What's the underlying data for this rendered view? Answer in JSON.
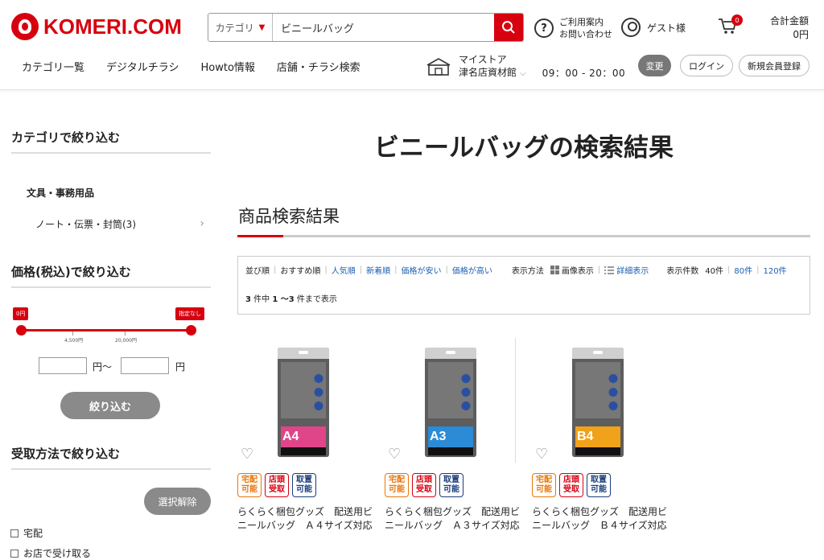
{
  "header": {
    "logo_text": "KOMERI.COM",
    "search": {
      "category_label": "カテゴリ",
      "query": "ビニールバッグ"
    },
    "help_line1": "ご利用案内",
    "help_line2": "お問い合わせ",
    "guest_label": "ゲスト様",
    "cart_count": "0",
    "total_label": "合計金額",
    "total_value": "0円",
    "nav": [
      "カテゴリ一覧",
      "デジタルチラシ",
      "Howto情報",
      "店舗・チラシ検索"
    ],
    "store": {
      "line1": "マイストア",
      "line2": "津名店資材館",
      "hours": "09：00 - 20：00"
    },
    "change_button": "変更",
    "login_button": "ログイン",
    "register_button": "新規会員登録"
  },
  "sidebar": {
    "category_heading": "カテゴリで絞り込む",
    "category_parent": "文具・事務用品",
    "category_child": "ノート・伝票・封筒(3)",
    "price_heading": "価格(税込)で絞り込む",
    "price_min_flag": "0円",
    "price_max_flag": "指定なし",
    "tick1": "4,500円",
    "tick2": "20,000円",
    "unit_from": "円〜",
    "unit_to": "円",
    "filter_button": "絞り込む",
    "pickup_heading": "受取方法で絞り込む",
    "clear_button": "選択解除",
    "options": [
      "宅配",
      "お店で受け取る"
    ]
  },
  "main": {
    "title": "ビニールバッグの検索結果",
    "section_title": "商品検索結果",
    "sort": {
      "label": "並び順",
      "current": "おすすめ順",
      "options": [
        "人気順",
        "新着順",
        "価格が安い",
        "価格が高い"
      ]
    },
    "view": {
      "label": "表示方法",
      "image": "画像表示",
      "detail": "詳細表示"
    },
    "per_page": {
      "label": "表示件数",
      "current": "40件",
      "options": [
        "80件",
        "120件"
      ]
    },
    "count": {
      "total": "3",
      "mid": " 件中 ",
      "range": "1 〜3",
      "tail": " 件まで表示"
    },
    "badges": {
      "home": "宅配\n可能",
      "store": "店頭\n受取",
      "keep": "取置\n可能"
    },
    "products": [
      {
        "name": "らくらく梱包グッズ　配送用ビニールバッグ　Ａ４サイズ対応",
        "size": "A4",
        "accent": "#e0458a"
      },
      {
        "name": "らくらく梱包グッズ　配送用ビニールバッグ　Ａ３サイズ対応",
        "size": "A3",
        "accent": "#2b8bd6"
      },
      {
        "name": "らくらく梱包グッズ　配送用ビニールバッグ　Ｂ４サイズ対応",
        "size": "B4",
        "accent": "#f0a21a"
      }
    ]
  },
  "colors": {
    "brand": "#d7000f",
    "link": "#1a5fb4"
  }
}
